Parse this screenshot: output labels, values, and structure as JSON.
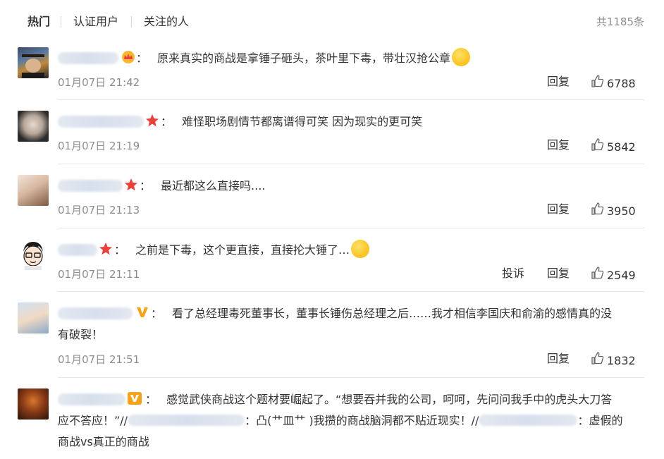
{
  "tabs": {
    "hot": "热门",
    "verified": "认证用户",
    "following": "关注的人",
    "total": "共1185条"
  },
  "colors": {
    "accent_orange": "#f7a21b",
    "star_red": "#e8433b",
    "muted": "#8c8c8c"
  },
  "comments": [
    {
      "text": "原来真实的商战是拿锤子砸头，茶叶里下毒，带壮汉抢公章",
      "colon": "：",
      "badge": "crown-icon",
      "emoji": "sweat-emoji",
      "date": "01月07日 21:42",
      "reply": "回复",
      "likes": "6788"
    },
    {
      "text": "难怪职场剧情节都离谱得可笑 因为现实的更可笑",
      "colon": "：",
      "badge": "star-icon",
      "date": "01月07日 21:19",
      "reply": "回复",
      "likes": "5842"
    },
    {
      "text": "最近都这么直接吗....",
      "colon": "：",
      "badge": "star-icon",
      "date": "01月07日 21:13",
      "reply": "回复",
      "likes": "3950"
    },
    {
      "text": "之前是下毒，这个更直接，直接抡大锤了…",
      "colon": "：",
      "badge": "star-icon",
      "emoji": "shush-emoji",
      "date": "01月07日 21:11",
      "report": "投诉",
      "reply": "回复",
      "likes": "2549"
    },
    {
      "text_line1": "看了总经理毒死董事长，董事长锤伤总经理之后……我才相信李国庆和俞渝的感情真的没",
      "text_line2": "有破裂！",
      "colon": "：",
      "badge": "v-icon",
      "date": "01月07日 21:51",
      "reply": "回复",
      "likes": "1832"
    },
    {
      "text_line1": "感觉武侠商战这个题材要崛起了。“想要吞并我的公司，呵呵，先问问我手中的虎头大刀答",
      "text_line2a": "应不答应！”//",
      "text_line2b": "：凸(艹皿艹 )我攒的商战脑洞都不贴近现实！//",
      "text_line2c": "：虚假的",
      "text_line3": "商战vs真正的商战",
      "colon": "：",
      "badge": "v-box-icon"
    }
  ]
}
